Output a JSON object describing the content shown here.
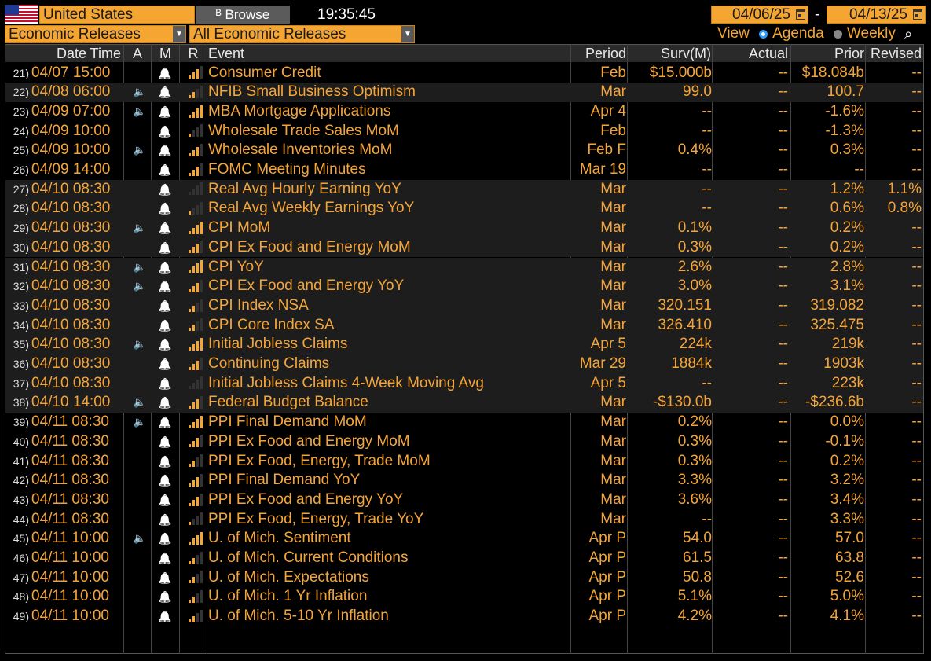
{
  "toolbar": {
    "country": "United States",
    "browse_label": "Browse",
    "clock": "19:35:45",
    "start_date": "04/06/25",
    "end_date": "04/13/25",
    "date_separator": "-",
    "category": "Economic Releases",
    "release_filter": "All Economic Releases",
    "view_label": "View",
    "view_agenda": "Agenda",
    "view_weekly": "Weekly"
  },
  "columns": {
    "datetime": "Date Time",
    "alert": "A",
    "monitor": "M",
    "relevance": "R",
    "event": "Event",
    "period": "Period",
    "survey": "Surv(M)",
    "actual": "Actual",
    "prior": "Prior",
    "revised": "Revised"
  },
  "colors": {
    "accent": "#f5a532",
    "background": "#000000",
    "shaded_row": "#1d1d1d"
  },
  "icons": {
    "speaker": "speaker-icon",
    "bell": "bell-icon",
    "relevance": "signal-bars-icon",
    "calendar": "calendar-icon",
    "zoom": "zoom-icon"
  },
  "rows": [
    {
      "n": "21)",
      "dt": "04/07 15:00",
      "spk": false,
      "rel": 3,
      "event": "Consumer Credit",
      "period": "Feb",
      "surv": "$15.000b",
      "actual": "--",
      "prior": "$18.084b",
      "revised": "--",
      "shade": false
    },
    {
      "n": "22)",
      "dt": "04/08 06:00",
      "spk": true,
      "rel": 2,
      "event": "NFIB Small Business Optimism",
      "period": "Mar",
      "surv": "99.0",
      "actual": "--",
      "prior": "100.7",
      "revised": "--",
      "shade": true
    },
    {
      "n": "23)",
      "dt": "04/09 07:00",
      "spk": true,
      "rel": 4,
      "event": "MBA Mortgage Applications",
      "period": "Apr 4",
      "surv": "--",
      "actual": "--",
      "prior": "-1.6%",
      "revised": "--",
      "shade": false
    },
    {
      "n": "24)",
      "dt": "04/09 10:00",
      "spk": false,
      "rel": 1,
      "event": "Wholesale Trade Sales MoM",
      "period": "Feb",
      "surv": "--",
      "actual": "--",
      "prior": "-1.3%",
      "revised": "--",
      "shade": false
    },
    {
      "n": "25)",
      "dt": "04/09 10:00",
      "spk": true,
      "rel": 3,
      "event": "Wholesale Inventories MoM",
      "period": "Feb F",
      "surv": "0.4%",
      "actual": "--",
      "prior": "0.3%",
      "revised": "--",
      "shade": false
    },
    {
      "n": "26)",
      "dt": "04/09 14:00",
      "spk": false,
      "rel": 3,
      "event": "FOMC Meeting Minutes",
      "period": "Mar 19",
      "surv": "--",
      "actual": "--",
      "prior": "--",
      "revised": "--",
      "shade": false
    },
    {
      "n": "27)",
      "dt": "04/10 08:30",
      "spk": false,
      "rel": 0,
      "event": "Real Avg Hourly Earning YoY",
      "period": "Mar",
      "surv": "--",
      "actual": "--",
      "prior": "1.2%",
      "revised": "1.1%",
      "shade": true
    },
    {
      "n": "28)",
      "dt": "04/10 08:30",
      "spk": false,
      "rel": 1,
      "event": "Real Avg Weekly Earnings YoY",
      "period": "Mar",
      "surv": "--",
      "actual": "--",
      "prior": "0.6%",
      "revised": "0.8%",
      "shade": true
    },
    {
      "n": "29)",
      "dt": "04/10 08:30",
      "spk": true,
      "rel": 4,
      "event": "CPI MoM",
      "period": "Mar",
      "surv": "0.1%",
      "actual": "--",
      "prior": "0.2%",
      "revised": "--",
      "shade": true
    },
    {
      "n": "30)",
      "dt": "04/10 08:30",
      "spk": false,
      "rel": 3,
      "event": "CPI Ex Food and Energy MoM",
      "period": "Mar",
      "surv": "0.3%",
      "actual": "--",
      "prior": "0.2%",
      "revised": "--",
      "shade": true
    },
    {
      "n": "31)",
      "dt": "04/10 08:30",
      "spk": true,
      "rel": 4,
      "event": "CPI YoY",
      "period": "Mar",
      "surv": "2.6%",
      "actual": "--",
      "prior": "2.8%",
      "revised": "--",
      "shade": true
    },
    {
      "n": "32)",
      "dt": "04/10 08:30",
      "spk": true,
      "rel": 3,
      "event": "CPI Ex Food and Energy YoY",
      "period": "Mar",
      "surv": "3.0%",
      "actual": "--",
      "prior": "3.1%",
      "revised": "--",
      "shade": true
    },
    {
      "n": "33)",
      "dt": "04/10 08:30",
      "spk": false,
      "rel": 2,
      "event": "CPI Index NSA",
      "period": "Mar",
      "surv": "320.151",
      "actual": "--",
      "prior": "319.082",
      "revised": "--",
      "shade": true
    },
    {
      "n": "34)",
      "dt": "04/10 08:30",
      "spk": false,
      "rel": 2,
      "event": "CPI Core Index SA",
      "period": "Mar",
      "surv": "326.410",
      "actual": "--",
      "prior": "325.475",
      "revised": "--",
      "shade": true
    },
    {
      "n": "35)",
      "dt": "04/10 08:30",
      "spk": true,
      "rel": 4,
      "event": "Initial Jobless Claims",
      "period": "Apr 5",
      "surv": "224k",
      "actual": "--",
      "prior": "219k",
      "revised": "--",
      "shade": true
    },
    {
      "n": "36)",
      "dt": "04/10 08:30",
      "spk": false,
      "rel": 3,
      "event": "Continuing Claims",
      "period": "Mar 29",
      "surv": "1884k",
      "actual": "--",
      "prior": "1903k",
      "revised": "--",
      "shade": true
    },
    {
      "n": "37)",
      "dt": "04/10 08:30",
      "spk": false,
      "rel": 0,
      "event": "Initial Jobless Claims 4-Week Moving Avg",
      "period": "Apr 5",
      "surv": "--",
      "actual": "--",
      "prior": "223k",
      "revised": "--",
      "shade": true
    },
    {
      "n": "38)",
      "dt": "04/10 14:00",
      "spk": true,
      "rel": 3,
      "event": "Federal Budget Balance",
      "period": "Mar",
      "surv": "-$130.0b",
      "actual": "--",
      "prior": "-$236.6b",
      "revised": "--",
      "shade": true
    },
    {
      "n": "39)",
      "dt": "04/11 08:30",
      "spk": true,
      "rel": 4,
      "event": "PPI Final Demand MoM",
      "period": "Mar",
      "surv": "0.2%",
      "actual": "--",
      "prior": "0.0%",
      "revised": "--",
      "shade": false
    },
    {
      "n": "40)",
      "dt": "04/11 08:30",
      "spk": false,
      "rel": 3,
      "event": "PPI Ex Food and Energy MoM",
      "period": "Mar",
      "surv": "0.3%",
      "actual": "--",
      "prior": "-0.1%",
      "revised": "--",
      "shade": false
    },
    {
      "n": "41)",
      "dt": "04/11 08:30",
      "spk": false,
      "rel": 2,
      "event": "PPI Ex Food, Energy, Trade MoM",
      "period": "Mar",
      "surv": "0.3%",
      "actual": "--",
      "prior": "0.2%",
      "revised": "--",
      "shade": false
    },
    {
      "n": "42)",
      "dt": "04/11 08:30",
      "spk": false,
      "rel": 3,
      "event": "PPI Final Demand YoY",
      "period": "Mar",
      "surv": "3.3%",
      "actual": "--",
      "prior": "3.2%",
      "revised": "--",
      "shade": false
    },
    {
      "n": "43)",
      "dt": "04/11 08:30",
      "spk": false,
      "rel": 3,
      "event": "PPI Ex Food and Energy YoY",
      "period": "Mar",
      "surv": "3.6%",
      "actual": "--",
      "prior": "3.4%",
      "revised": "--",
      "shade": false
    },
    {
      "n": "44)",
      "dt": "04/11 08:30",
      "spk": false,
      "rel": 1,
      "event": "PPI Ex Food, Energy, Trade YoY",
      "period": "Mar",
      "surv": "--",
      "actual": "--",
      "prior": "3.3%",
      "revised": "--",
      "shade": false
    },
    {
      "n": "45)",
      "dt": "04/11 10:00",
      "spk": true,
      "rel": 4,
      "event": "U. of Mich. Sentiment",
      "period": "Apr P",
      "surv": "54.0",
      "actual": "--",
      "prior": "57.0",
      "revised": "--",
      "shade": false
    },
    {
      "n": "46)",
      "dt": "04/11 10:00",
      "spk": false,
      "rel": 2,
      "event": "U. of Mich. Current Conditions",
      "period": "Apr P",
      "surv": "61.5",
      "actual": "--",
      "prior": "63.8",
      "revised": "--",
      "shade": false
    },
    {
      "n": "47)",
      "dt": "04/11 10:00",
      "spk": false,
      "rel": 2,
      "event": "U. of Mich. Expectations",
      "period": "Apr P",
      "surv": "50.8",
      "actual": "--",
      "prior": "52.6",
      "revised": "--",
      "shade": false
    },
    {
      "n": "48)",
      "dt": "04/11 10:00",
      "spk": false,
      "rel": 2,
      "event": "U. of Mich. 1 Yr Inflation",
      "period": "Apr P",
      "surv": "5.1%",
      "actual": "--",
      "prior": "5.0%",
      "revised": "--",
      "shade": false
    },
    {
      "n": "49)",
      "dt": "04/11 10:00",
      "spk": false,
      "rel": 2,
      "event": "U. of Mich. 5-10 Yr Inflation",
      "period": "Apr P",
      "surv": "4.2%",
      "actual": "--",
      "prior": "4.1%",
      "revised": "--",
      "shade": false
    }
  ]
}
